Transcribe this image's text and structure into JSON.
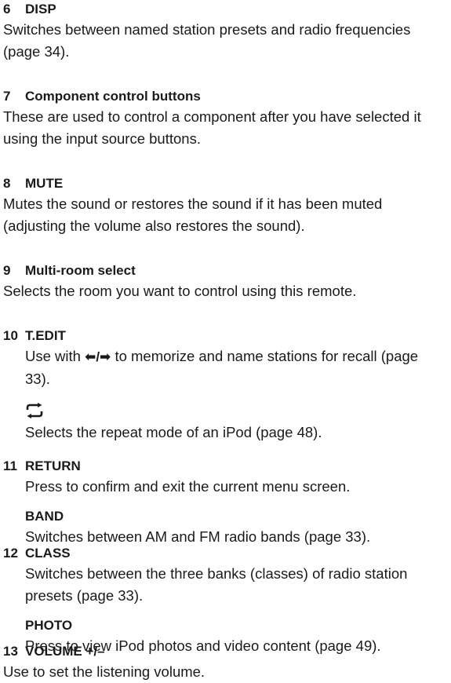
{
  "entries": [
    {
      "number": "6",
      "title": "DISP",
      "text": "Switches between named station presets and radio frequencies (page 34)."
    },
    {
      "number": "7",
      "title": "Component control buttons",
      "text": "These are used to control a component after you have selected it using the input source buttons."
    },
    {
      "number": "8",
      "title": "MUTE",
      "text": "Mutes the sound or restores the sound if it has been muted (adjusting the volume also restores the sound)."
    },
    {
      "number": "9",
      "title": "Multi-room select",
      "text": "Selects the room you want to control using this remote."
    },
    {
      "number": "10",
      "title": "T.EDIT",
      "text_before": "Use with",
      "arrows": "⬅/➡",
      "text_after": "to memorize and name stations for recall (page 33).",
      "sub": {
        "icon": "repeat-icon",
        "text": "Selects the repeat mode of an iPod (page 48)."
      }
    },
    {
      "number": "11",
      "title": "RETURN",
      "text": "Press to confirm and exit the current menu screen.",
      "sub": {
        "title": "BAND",
        "text": "Switches between AM and FM radio bands (page 33)."
      }
    },
    {
      "number": "12",
      "title": "CLASS",
      "text": "Switches between the three banks (classes) of radio station presets (page 33).",
      "sub": {
        "title": "PHOTO",
        "text": "Press to view iPod photos and video content (page 49)."
      }
    },
    {
      "number": "13",
      "title": "VOLUME +/–",
      "text": "Use to set the listening volume."
    }
  ]
}
